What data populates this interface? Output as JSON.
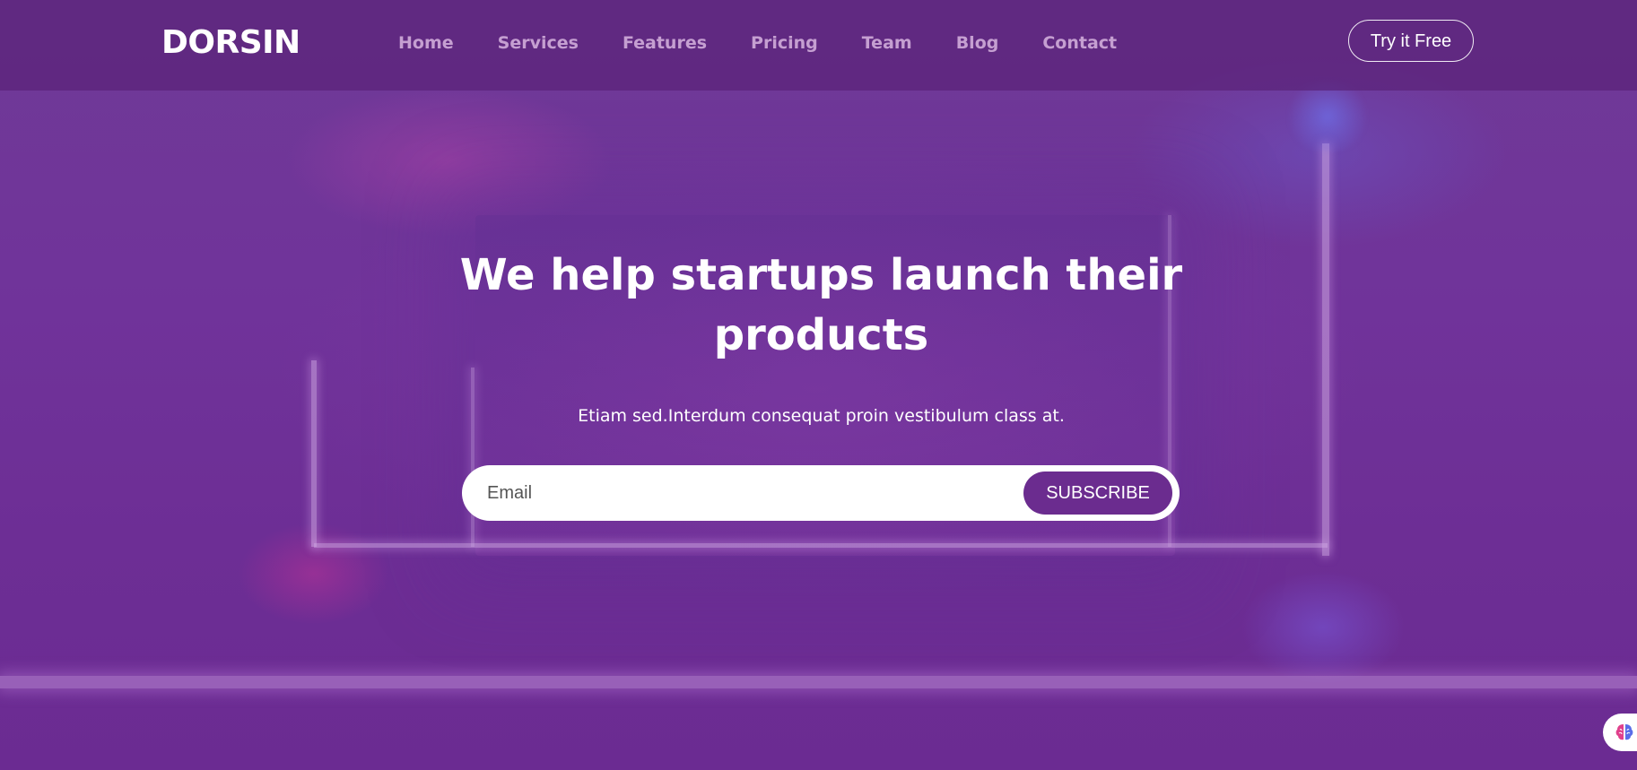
{
  "header": {
    "brand": "DORSIN",
    "nav": [
      {
        "label": "Home"
      },
      {
        "label": "Services"
      },
      {
        "label": "Features"
      },
      {
        "label": "Pricing"
      },
      {
        "label": "Team"
      },
      {
        "label": "Blog"
      },
      {
        "label": "Contact"
      }
    ],
    "cta_label": "Try it Free"
  },
  "hero": {
    "title": "We help startups launch their products",
    "subtitle": "Etiam sed.Interdum consequat proin vestibulum class at.",
    "email_placeholder": "Email",
    "email_value": "",
    "subscribe_label": "SUBSCRIBE"
  },
  "widget": {
    "icon": "brain-icon"
  },
  "colors": {
    "accent": "#6b2c8f",
    "header_bg": "#5a2378",
    "hero_bg": "#6e2f95",
    "text_light": "#ffffff",
    "nav_text": "#e6c8ee"
  }
}
